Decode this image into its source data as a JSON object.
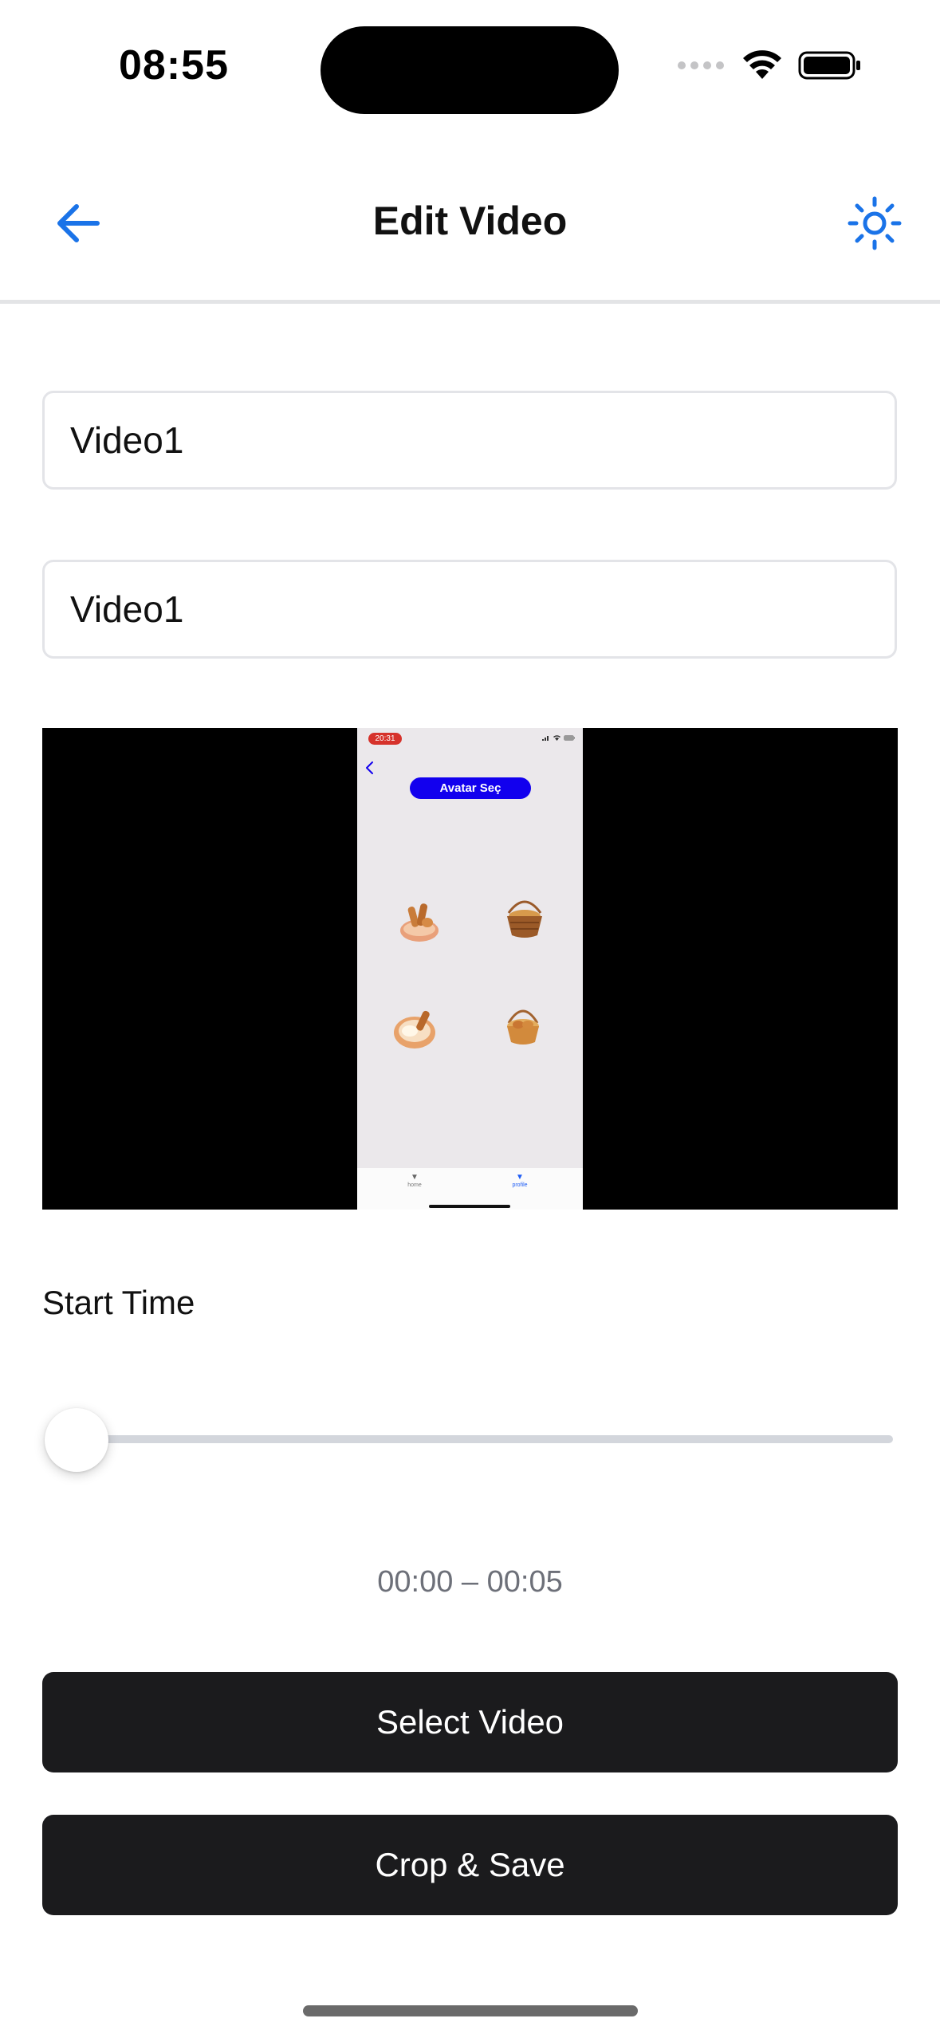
{
  "status_bar": {
    "time": "08:55"
  },
  "header": {
    "title": "Edit Video",
    "back_icon": "arrow-left-icon",
    "theme_icon": "sun-icon",
    "accent_color": "#1a73e8"
  },
  "form": {
    "title_value": "Video1",
    "description_value": "Video1"
  },
  "video_preview": {
    "frame": {
      "status_time": "20:31",
      "title": "Avatar Seç",
      "tabs": [
        {
          "label": "home",
          "active": false
        },
        {
          "label": "profile",
          "active": true
        }
      ]
    }
  },
  "trim": {
    "label": "Start Time",
    "slider_value": 0,
    "range_text": "00:00 – 00:05"
  },
  "actions": {
    "select_label": "Select Video",
    "crop_label": "Crop & Save"
  }
}
